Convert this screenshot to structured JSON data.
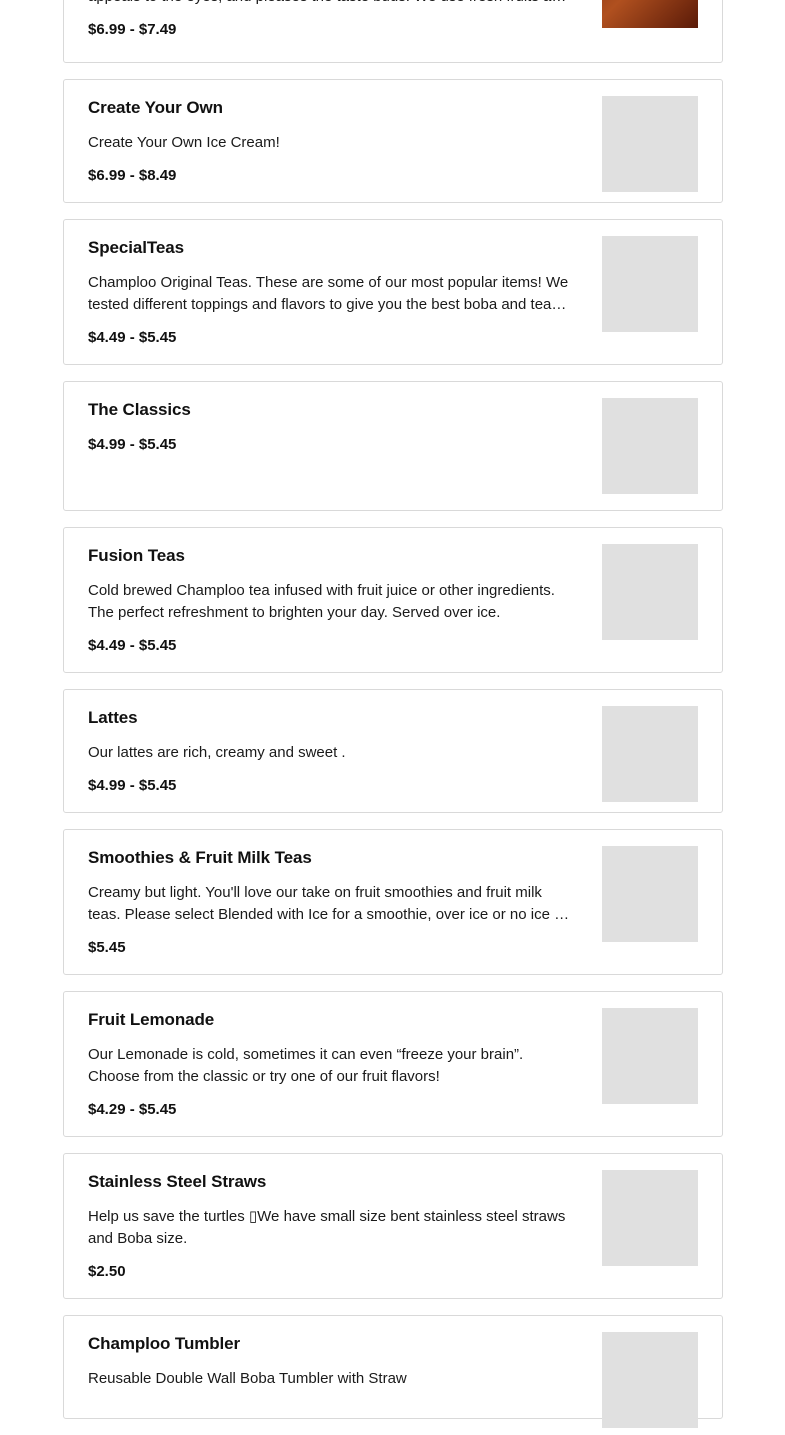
{
  "items": [
    {
      "title": "",
      "description": "appeals to the eyes, and pleases the taste buds. We use fresh fruits and quali…",
      "price": "$6.99 - $7.49"
    },
    {
      "title": "Create Your Own",
      "description": "Create Your Own Ice Cream!",
      "price": "$6.99 - $8.49"
    },
    {
      "title": "SpecialTeas",
      "description": "Champloo Original Teas. These are some of our most popular items! We tested different toppings and flavors to give you the best boba and tea…",
      "price": "$4.49 - $5.45"
    },
    {
      "title": "The Classics",
      "description": "",
      "price": "$4.99 - $5.45"
    },
    {
      "title": "Fusion Teas",
      "description": "Cold brewed Champloo tea infused with fruit juice or other ingredients. The perfect refreshment to brighten your day. Served over ice.",
      "price": "$4.49 - $5.45"
    },
    {
      "title": "Lattes",
      "description": "Our lattes are rich, creamy and sweet .",
      "price": "$4.99 - $5.45"
    },
    {
      "title": "Smoothies & Fruit Milk Teas",
      "description": "Creamy but light. You'll love our take on fruit smoothies and fruit milk teas. Please select Blended with Ice for a smoothie, over ice or no ice for fruit milk…",
      "price": "$5.45"
    },
    {
      "title": "Fruit Lemonade",
      "description": "Our Lemonade is cold, sometimes it can even “freeze your brain”. Choose from the classic or try one of our fruit flavors!",
      "price": "$4.29 - $5.45"
    },
    {
      "title": "Stainless Steel Straws",
      "description": "Help us save the turtles ▯We have small size bent stainless steel straws and Boba size.",
      "price": "$2.50"
    },
    {
      "title": "Champloo Tumbler",
      "description": "Reusable Double Wall Boba Tumbler with Straw",
      "price": ""
    }
  ]
}
